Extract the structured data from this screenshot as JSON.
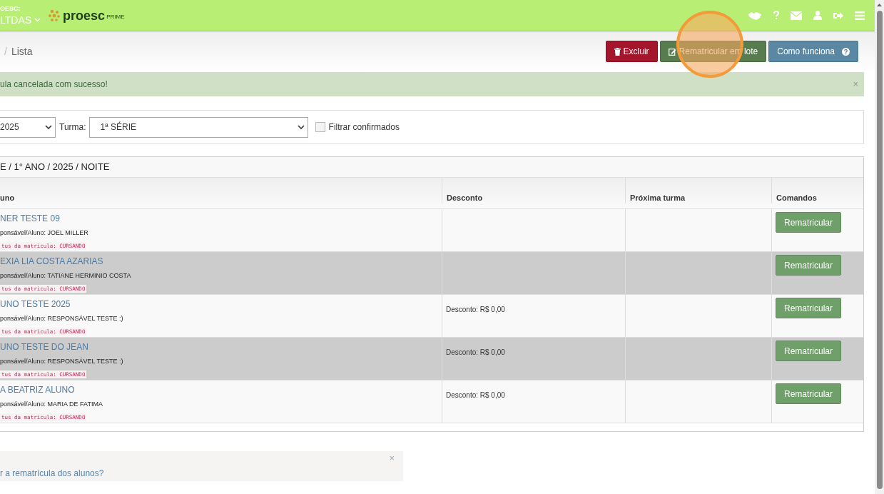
{
  "header": {
    "school_label": "OESC:",
    "school_name": "LTDAS",
    "logo_text": "proesc",
    "logo_suffix": "PRIME"
  },
  "breadcrumb": {
    "separator": "/",
    "current": "Lista"
  },
  "actions": [
    {
      "label": "Excluir",
      "kind": "danger"
    },
    {
      "label": "Rematricular em lote",
      "kind": "success"
    },
    {
      "label": "Como funciona",
      "kind": "info"
    }
  ],
  "alert": {
    "message": "ula cancelada com sucesso!",
    "close": "×"
  },
  "filters": {
    "year": "2025",
    "class_label": "Turma:",
    "class_value": "1ª SÉRIE",
    "confirmed_label": "Filtrar confirmados",
    "confirmed_checked": false
  },
  "table": {
    "title": "E / 1° ANO / 2025 / NOITE",
    "columns": [
      "uno",
      "Desconto",
      "Próxima turma",
      "Comandos"
    ],
    "rows": [
      {
        "name": "NER TESTE 09",
        "guardian": "ponsável/Aluno: JOEL MILLER",
        "status": "tus da matricula: CURSANDO",
        "discount": "",
        "button": "Rematricular",
        "highlighted": false
      },
      {
        "name": "EXIA LIA COSTA AZARIAS",
        "guardian": "ponsável/Aluno: TATIANE HERMINIO COSTA",
        "status": "tus da matricula: CURSANDO",
        "discount": "",
        "button": "Rematricular",
        "highlighted": true
      },
      {
        "name": "UNO TESTE 2025",
        "guardian": "ponsável/Aluno: RESPONSÁVEL TESTE :)",
        "status": "tus da matricula: CURSANDO",
        "discount": "Desconto: R$ 0,00",
        "button": "Rematricular",
        "highlighted": false
      },
      {
        "name": "UNO TESTE DO JEAN",
        "guardian": "ponsável/Aluno: RESPONSÁVEL TESTE :)",
        "status": "tus da matricula: CURSANDO",
        "discount": "Desconto: R$ 0,00",
        "button": "Rematricular",
        "highlighted": true
      },
      {
        "name": "A BEATRIZ ALUNO",
        "guardian": "ponsável/Aluno: MARIA DE FATIMA",
        "status": "tus da matricula: CURSANDO",
        "discount": "Desconto: R$ 0,00",
        "button": "Rematricular",
        "highlighted": false
      }
    ]
  },
  "help": {
    "link": "r a rematrícula dos alunos?",
    "close": "×"
  }
}
